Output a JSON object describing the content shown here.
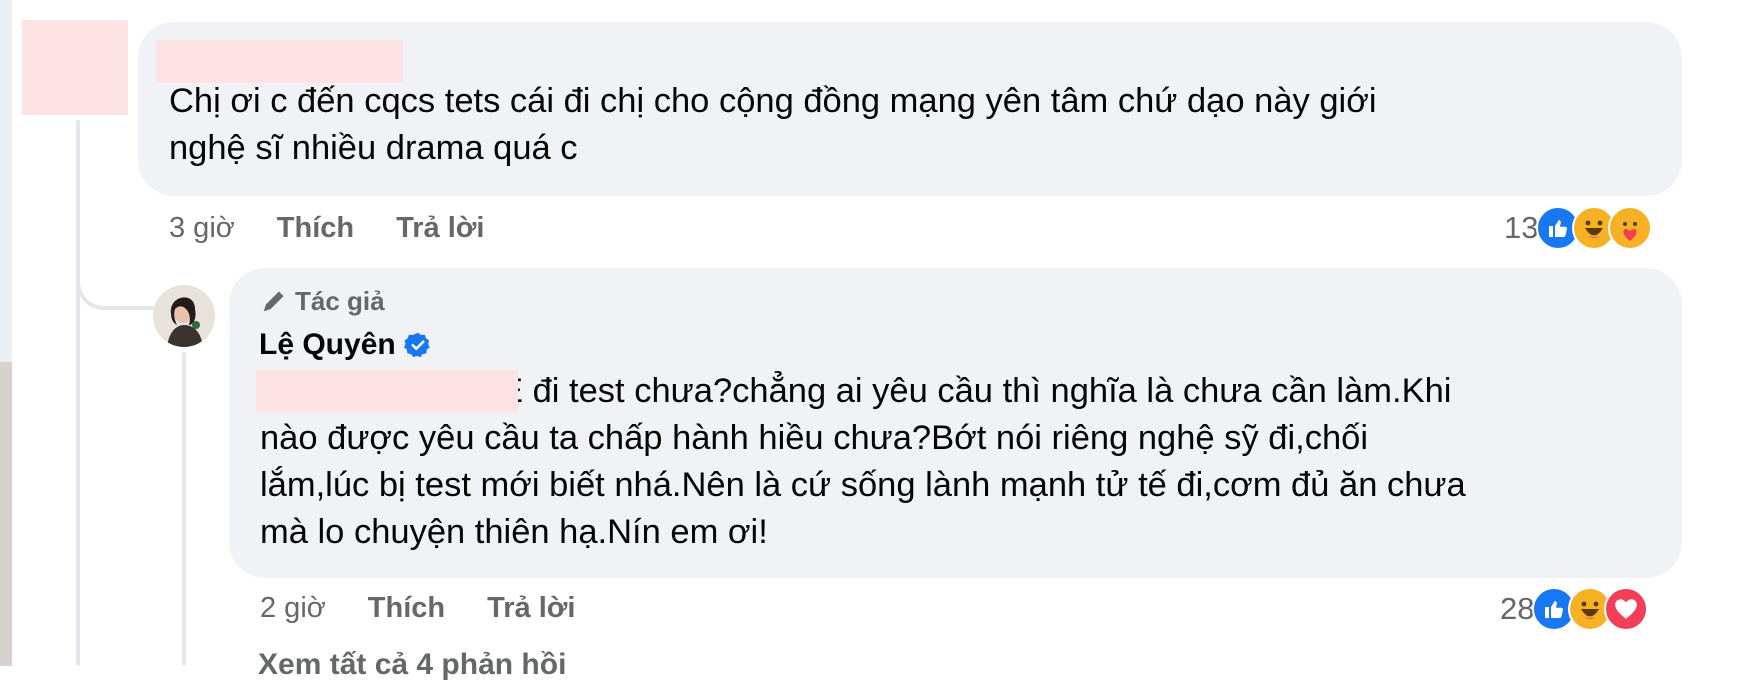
{
  "comment1": {
    "text_line1": "Chị ơi c đến cqcs tets cái đi chị cho cộng đồng mạng yên tâm chứ dạo này giới",
    "text_line2": "nghệ sĩ nhiều drama quá c",
    "time": "3 giờ",
    "like_label": "Thích",
    "reply_label": "Trả lời",
    "reaction_count": "13",
    "reactions": [
      "like-icon",
      "haha-icon",
      "care-icon"
    ]
  },
  "reply1": {
    "badge_label": "Tác giả",
    "author_name": "Lệ Quyên",
    "verified": true,
    "text_line1": "E đi test chưa?chẳng ai yêu cầu thì nghĩa là chưa cần làm.Khi",
    "text_line2": "nào được yêu cầu ta chấp hành hiều chưa?Bớt nói riêng nghệ sỹ đi,chối",
    "text_line3": "lắm,lúc bị test mới biết nhá.Nên là cứ sống lành mạnh tử tế đi,cơm đủ ăn chưa",
    "text_line4": "mà lo chuyện thiên hạ.Nín em ơi!",
    "time": "2 giờ",
    "like_label": "Thích",
    "reply_label": "Trả lời",
    "reaction_count": "28",
    "reactions": [
      "like-icon",
      "haha-icon",
      "love-icon"
    ]
  },
  "more_replies_label": "Xem tất cả 4 phản hồi",
  "colors": {
    "bubble": "#f0f2f5",
    "meta_text": "#65676b",
    "like_blue": "#1877f2",
    "haha_yellow": "#f7b125",
    "love_red": "#f33e58",
    "verified_blue": "#1877f2",
    "redaction": "#fde3e3"
  }
}
